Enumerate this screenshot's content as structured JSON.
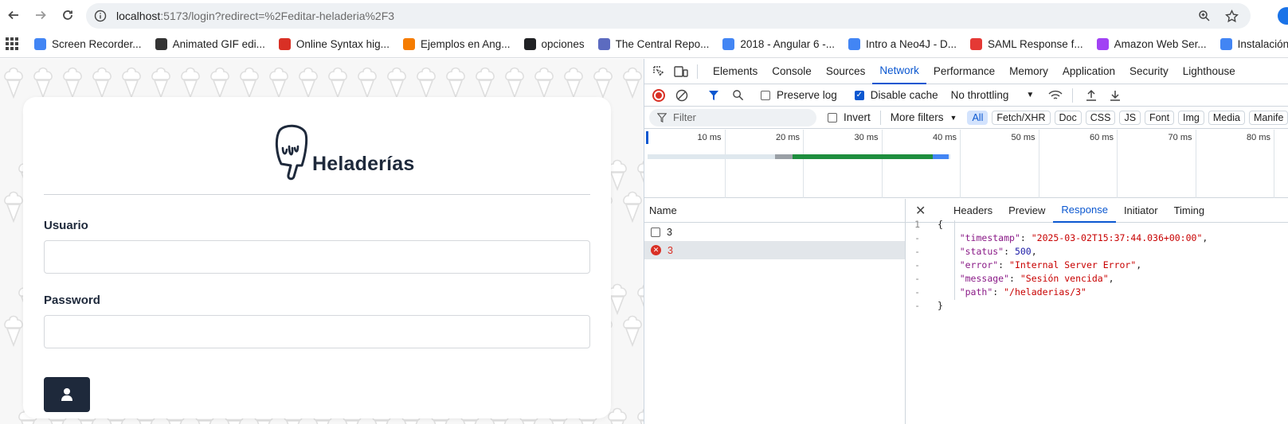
{
  "browser": {
    "url_host": "localhost",
    "url_rest": ":5173/login?redirect=%2Feditar-heladeria%2F3",
    "bookmarks": [
      {
        "label": "Screen Recorder...",
        "color": "#4285f4"
      },
      {
        "label": "Animated GIF edi...",
        "color": "#333333"
      },
      {
        "label": "Online Syntax hig...",
        "color": "#d93025"
      },
      {
        "label": "Ejemplos en Ang...",
        "color": "#f57c00"
      },
      {
        "label": "opciones",
        "color": "#202124"
      },
      {
        "label": "The Central Repo...",
        "color": "#5c6bc0"
      },
      {
        "label": "2018 - Angular 6 -...",
        "color": "#4285f4"
      },
      {
        "label": "Intro a Neo4J - D...",
        "color": "#4285f4"
      },
      {
        "label": "SAML Response f...",
        "color": "#e53935"
      },
      {
        "label": "Amazon Web Ser...",
        "color": "#a142f4"
      },
      {
        "label": "Instalación",
        "color": "#4285f4"
      }
    ]
  },
  "app": {
    "brand": "Heladerías",
    "username_label": "Usuario",
    "password_label": "Password",
    "username_value": "",
    "password_value": "",
    "accent": "#1e293b"
  },
  "devtools": {
    "tabs": [
      "Elements",
      "Console",
      "Sources",
      "Network",
      "Performance",
      "Memory",
      "Application",
      "Security",
      "Lighthouse"
    ],
    "active_tab": "Network",
    "preserve_log": "Preserve log",
    "disable_cache": "Disable cache",
    "throttling": "No throttling",
    "filter_placeholder": "Filter",
    "invert": "Invert",
    "more_filters": "More filters",
    "type_filters": [
      "All",
      "Fetch/XHR",
      "Doc",
      "CSS",
      "JS",
      "Font",
      "Img",
      "Media",
      "Manife"
    ],
    "timeline_ticks": [
      "10 ms",
      "20 ms",
      "30 ms",
      "40 ms",
      "50 ms",
      "60 ms",
      "70 ms",
      "80 ms"
    ],
    "name_header": "Name",
    "requests": [
      {
        "name": "3",
        "status": "ok"
      },
      {
        "name": "3",
        "status": "error"
      }
    ],
    "response_tabs": [
      "Headers",
      "Preview",
      "Response",
      "Initiator",
      "Timing"
    ],
    "active_response_tab": "Response",
    "response": {
      "gutter_first": "1",
      "gutter_other": "-",
      "open": "{",
      "close": "}",
      "fields": [
        {
          "key": "\"timestamp\"",
          "value": "\"2025-03-02T15:37:44.036+00:00\"",
          "type": "string"
        },
        {
          "key": "\"status\"",
          "value": "500",
          "type": "number"
        },
        {
          "key": "\"error\"",
          "value": "\"Internal Server Error\"",
          "type": "string"
        },
        {
          "key": "\"message\"",
          "value": "\"Sesión vencida\"",
          "type": "string"
        },
        {
          "key": "\"path\"",
          "value": "\"/heladerias/3\"",
          "type": "string"
        }
      ]
    }
  }
}
